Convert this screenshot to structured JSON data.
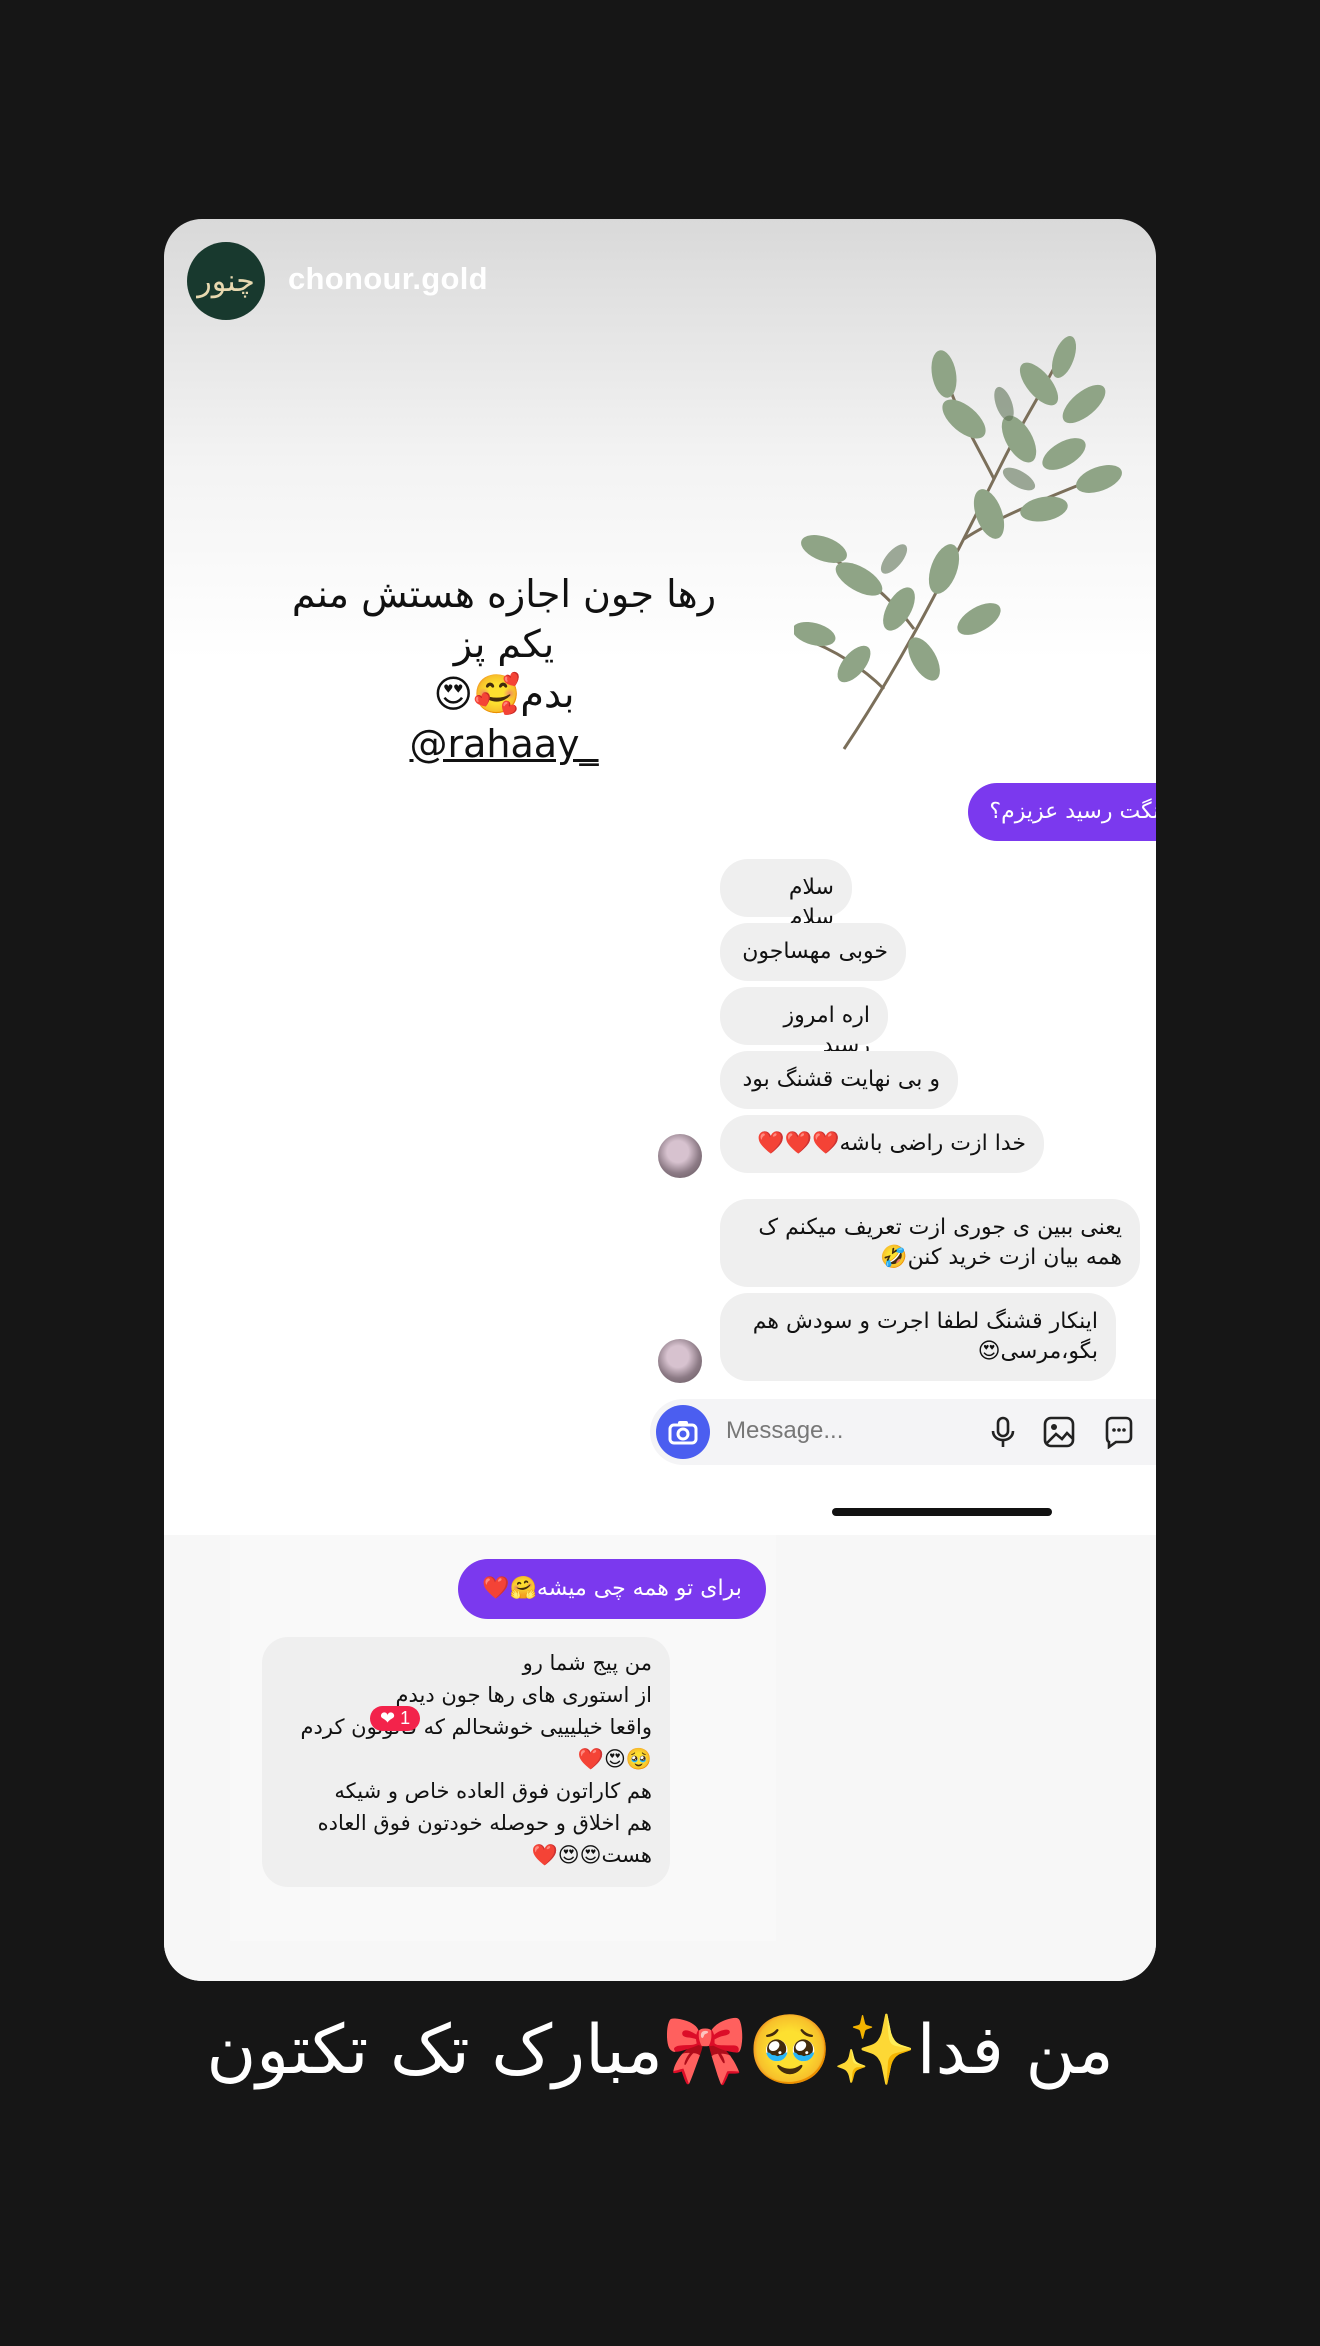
{
  "story": {
    "account_name": "chonour.gold",
    "logo_text": "چنور",
    "note_line1": "رها جون اجازه هستش منم یکم پز",
    "note_line2": "بدم🥰😍",
    "mention": "@rahaay_"
  },
  "dm1": {
    "sent_message": "قشنگت رسید عزیزم؟",
    "received": [
      "سلام سلام",
      "خوبی مهساجون",
      "اره امروز رسید",
      "و بی نهایت قشنگ بود",
      "خدا ازت راضی باشه❤️❤️❤️",
      "یعنی ببین ی جوری ازت تعریف میکنم ک همه بیان ازت خرید کنن🤣",
      "اینکار قشنگ لطفا اجرت و سودش هم بگو،مرسی😍"
    ],
    "message_placeholder": "Message...",
    "icons": [
      "camera-icon",
      "microphone-icon",
      "image-icon",
      "sticker-icon"
    ]
  },
  "dm2": {
    "sent_message": "برای تو همه چی میشه🤗❤️",
    "received_lines": [
      "من پیج شما رو",
      "از استوری های رها جون دیدم",
      "واقعا خیلیییی خوشحالم که فالوتون کردم",
      "🥹😍❤️",
      "هم کاراتون فوق العاده خاص و شیکه",
      "هم اخلاق و حوصله خودتون فوق العاده",
      "هست😍😍❤️"
    ],
    "like_count": "1"
  },
  "caption": "من فدا✨🥹🎀مبارک تک تکتون",
  "colors": {
    "background": "#161616",
    "sent_bubble": "#7b39ee",
    "received_bubble": "#efefef",
    "camera_button": "#4b5ef0",
    "logo_bg": "#18392e",
    "like_badge": "#f3234b"
  }
}
